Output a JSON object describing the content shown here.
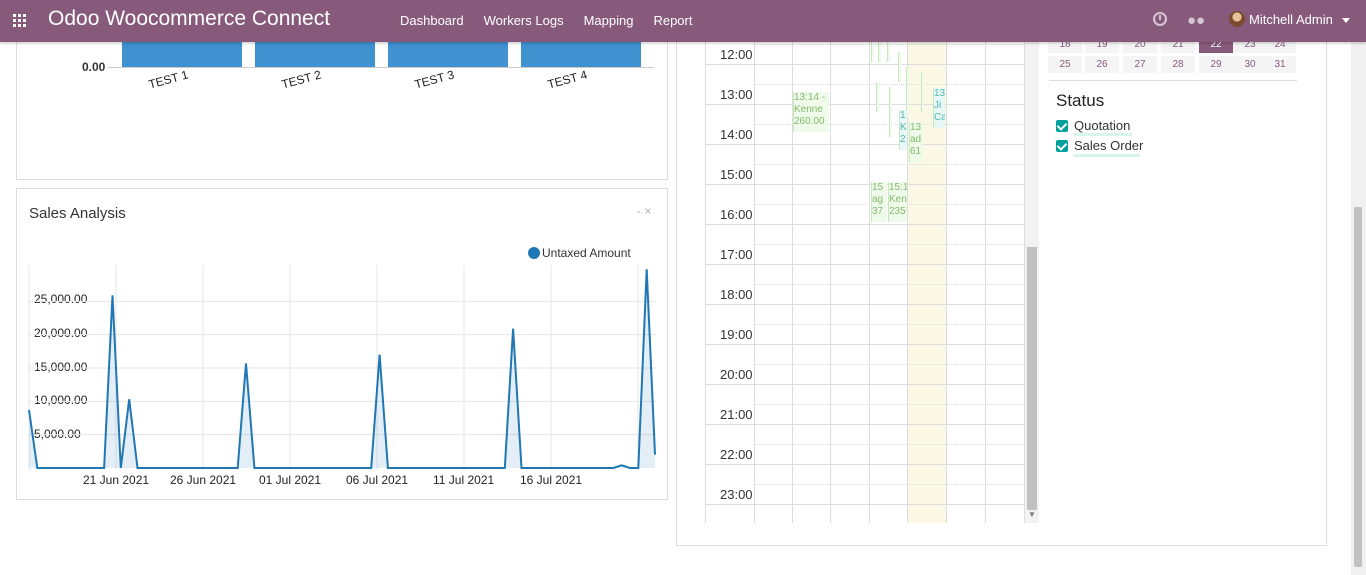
{
  "app": {
    "title": "Odoo Woocommerce Connect",
    "menu": [
      "Dashboard",
      "Workers Logs",
      "Mapping",
      "Report"
    ],
    "user": "Mitchell Admin",
    "colors": {
      "brand": "#875A7B",
      "chart_line": "#1f77b4"
    }
  },
  "bar_chart": {
    "zero_label": "0.00",
    "labels": [
      "TEST 1",
      "TEST 2",
      "TEST 3",
      "TEST 4"
    ]
  },
  "sales_chart": {
    "title": "Sales Analysis",
    "controls": "- ×",
    "legend": "Untaxed Amount",
    "yticks": [
      "25,000.00",
      "20,000.00",
      "15,000.00",
      "10,000.00",
      "5,000.00"
    ],
    "xticks": [
      "21 Jun 2021",
      "26 Jun 2021",
      "01 Jul 2021",
      "06 Jul 2021",
      "11 Jul 2021",
      "16 Jul 2021"
    ]
  },
  "chart_data": {
    "type": "area",
    "title": "Sales Analysis",
    "series": [
      {
        "name": "Untaxed Amount",
        "values": [
          8700,
          0,
          0,
          0,
          0,
          0,
          0,
          0,
          0,
          0,
          25900,
          0,
          10300,
          0,
          0,
          0,
          0,
          0,
          0,
          0,
          0,
          0,
          0,
          0,
          0,
          0,
          15700,
          0,
          0,
          0,
          0,
          0,
          0,
          0,
          0,
          0,
          0,
          0,
          0,
          0,
          0,
          0,
          17000,
          0,
          0,
          0,
          0,
          0,
          0,
          0,
          0,
          0,
          0,
          0,
          0,
          0,
          0,
          0,
          20900,
          0,
          0,
          0,
          0,
          0,
          0,
          0,
          0,
          0,
          0,
          0,
          0,
          400,
          0,
          0,
          29800,
          2000
        ]
      }
    ],
    "x_start": "16 Jun 2021",
    "x_step": "quarter-day intervals",
    "ylim": [
      0,
      30000
    ],
    "grid": true,
    "legend": "top-right"
  },
  "calendar": {
    "times": [
      "12:00",
      "13:00",
      "14:00",
      "15:00",
      "16:00",
      "17:00",
      "18:00",
      "19:00",
      "20:00",
      "21:00",
      "22:00",
      "23:00"
    ],
    "events": [
      {
        "text": "13:14 - Kenne 260.00"
      },
      {
        "text": "1 K 2"
      },
      {
        "text": "13 ad 61"
      },
      {
        "text": "13 Ji Ca"
      },
      {
        "text": "15 ag 37"
      },
      {
        "text": "15:1 Ken 235"
      }
    ]
  },
  "mini_calendar": {
    "row1": [
      "18",
      "19",
      "20",
      "21",
      "22",
      "23",
      "24"
    ],
    "row2": [
      "25",
      "26",
      "27",
      "28",
      "29",
      "30",
      "31"
    ],
    "selected": "22"
  },
  "status": {
    "title": "Status",
    "items": [
      "Quotation",
      "Sales Order"
    ]
  }
}
